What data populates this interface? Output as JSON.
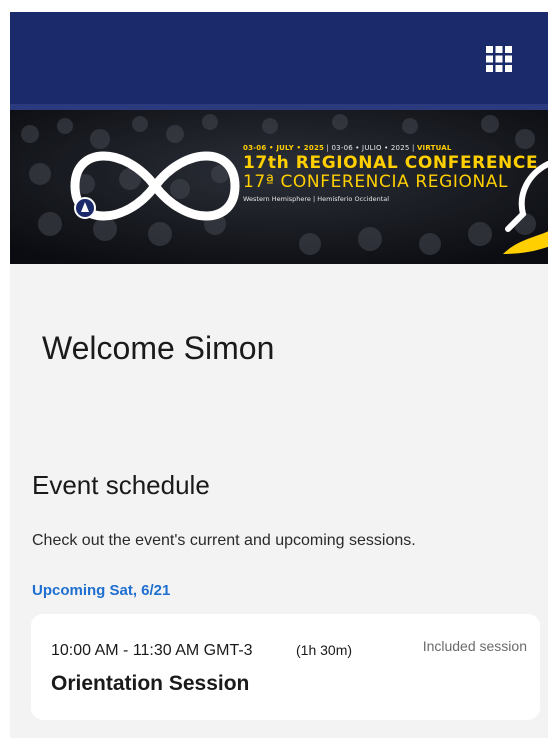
{
  "header": {
    "apps_icon": "grid-apps-icon",
    "background_color": "#1b2a6a"
  },
  "banner": {
    "dates_en": "03-06 • JULY • 2025",
    "dates_es": "03-06 • JULIO • 2025",
    "mode": "VIRTUAL",
    "title_en": "17th REGIONAL CONFERENCE",
    "title_es": "17ª CONFERENCIA REGIONAL",
    "subtitle": "Western Hemisphere | Hemisferio Occidental",
    "logo_icon": "infinity-hands-logo",
    "accent_color": "#ffcf00"
  },
  "welcome": {
    "text": "Welcome Simon"
  },
  "schedule": {
    "title": "Event schedule",
    "description": "Check out the event's current and upcoming sessions.",
    "upcoming_label": "Upcoming Sat, 6/21",
    "link_color": "#1f6fd1",
    "sessions": [
      {
        "time": "10:00 AM - 11:30 AM GMT-3",
        "duration": "(1h 30m)",
        "tag": "Included session",
        "name": "Orientation Session"
      }
    ]
  }
}
